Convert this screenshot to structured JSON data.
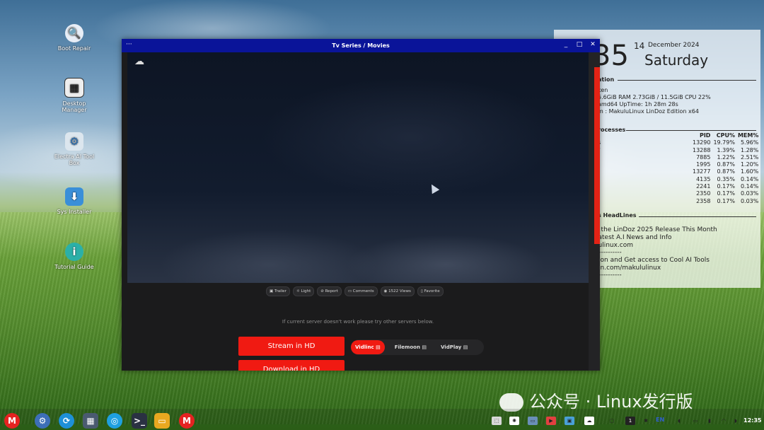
{
  "desktop": {
    "icons": [
      {
        "label": "Boot Repair",
        "glyph": "🔍"
      },
      {
        "label": "Desktop Manager",
        "glyph": "▦"
      },
      {
        "label": "Electra AI Tool Box",
        "glyph": "⚙"
      },
      {
        "label": "Sys Installer",
        "glyph": "⬇"
      },
      {
        "label": "Tutorial Guide",
        "glyph": "i"
      }
    ]
  },
  "conky": {
    "time_partial": "35",
    "day": "14",
    "month_year": "December 2024",
    "weekday": "Saturday",
    "section_info": "ation",
    "info_lines": [
      "ken",
      "5.6GiB       RAM    2.73GiB / 11.5GiB        CPU     22%",
      "amd64        UpTime: 1h 28m 28s",
      "m :   MakuluLinux LinDoz Edition x64"
    ],
    "section_processes": "rocesses",
    "proc_headers": [
      "PID",
      "CPU%",
      "MEM%"
    ],
    "proc_partial_names": [
      "s",
      "r"
    ],
    "processes": [
      [
        "13290",
        "19.79%",
        "5.96%"
      ],
      [
        "13288",
        "1.39%",
        "1.28%"
      ],
      [
        "7885",
        "1.22%",
        "2.51%"
      ],
      [
        "1995",
        "0.87%",
        "1.20%"
      ],
      [
        "13277",
        "0.87%",
        "1.60%"
      ],
      [
        "4135",
        "0.35%",
        "0.14%"
      ],
      [
        "2241",
        "0.17%",
        "0.14%"
      ],
      [
        "2350",
        "0.17%",
        "0.03%"
      ],
      [
        "2358",
        "0.17%",
        "0.03%"
      ]
    ],
    "section_headlines": "s HeadLines",
    "headlines": [
      "r the LinDoz 2025 Release This Month",
      "latest A.I News and Info",
      "lulinux.com",
      "-----------",
      "eon and Get access to Cool AI Tools",
      "on.com/makululinux",
      "-----------"
    ]
  },
  "window": {
    "title": "Tv Series / Movies",
    "menu_glyph": "···",
    "min_glyph": "_",
    "max_glyph": "□",
    "close_glyph": "✕",
    "actions": [
      "▣ Trailer",
      "☼ Light",
      "⊘ Report",
      "▭ Comments",
      "◉ 1522 Views",
      "▯ Favorite"
    ],
    "note": "If current server doesn't work please try other servers below.",
    "stream_label": "Stream in HD",
    "download_label": "Download in HD",
    "servers": [
      "Vidlinc",
      "Filemoon",
      "VidPlay"
    ],
    "server_glyph": "▤"
  },
  "taskbar": {
    "lang": "EN",
    "clock": "12:35",
    "badge": "1"
  },
  "watermark": "公众号 · Linux发行版"
}
